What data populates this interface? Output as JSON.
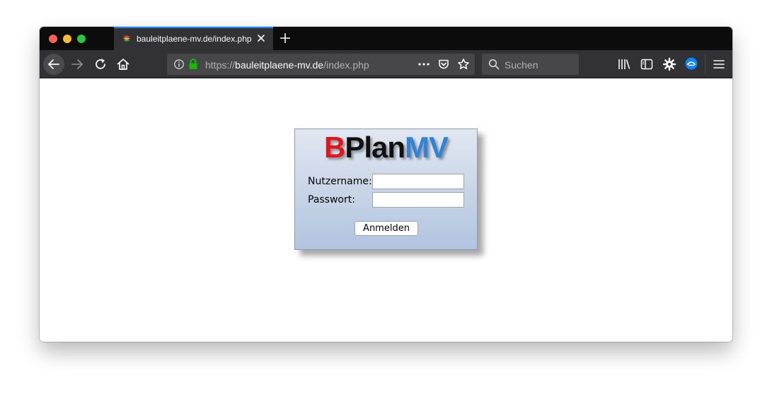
{
  "browser": {
    "tab": {
      "title": "bauleitplaene-mv.de/index.php"
    },
    "url": {
      "scheme": "https://",
      "host": "bauleitplaene-mv.de",
      "path": "/index.php"
    },
    "search": {
      "placeholder": "Suchen"
    }
  },
  "page": {
    "logo": {
      "part_b": "B",
      "part_plan": "Plan",
      "part_mv": "MV"
    },
    "form": {
      "username_label": "Nutzername:",
      "password_label": "Passwort:",
      "username_value": "",
      "password_value": "",
      "submit_label": "Anmelden"
    }
  },
  "colors": {
    "tab_accent": "#0a84ff",
    "logo_b": "#e3141b",
    "logo_plan": "#111111",
    "logo_mv": "#2f83d9",
    "lock": "#12bc00"
  }
}
